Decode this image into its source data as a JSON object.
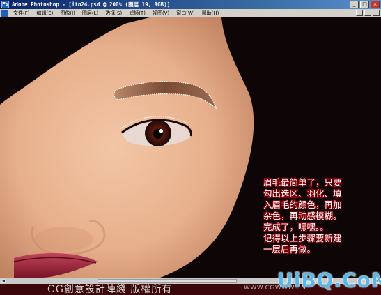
{
  "window": {
    "title": "Adobe Photoshop - [ito24.psd @ 200% (图层 19, RGB)]",
    "app_icon": "Ps",
    "buttons": [
      "_",
      "□",
      "×"
    ]
  },
  "menubar": {
    "items": [
      "文件(F)",
      "编辑(E)",
      "图像(I)",
      "图层(L)",
      "选择(S)",
      "滤镜(T)",
      "视图(V)",
      "窗口(W)",
      "帮助(H)"
    ]
  },
  "annotation": {
    "lines": [
      "眉毛最简单了，只要",
      "勾出选区、羽化、填",
      "入眉毛的颜色，再加",
      "杂色，再动感模糊。",
      "完成了，嘿嘿。。",
      "记得以上步骤要新建",
      "一层后再做。"
    ]
  },
  "footer": {
    "copyright": "CG創意設計陣綫 版權所有",
    "url": "WWW.CGWWW.CN"
  },
  "watermark": "UiBQ.CoM",
  "colors": {
    "titlebar": "#0a246a",
    "menubar": "#d4d0c8",
    "skin": "#e8b48f",
    "hair": "#0d0506",
    "note_outline": "#8c0008"
  },
  "icons": {
    "app": "photoshop-icon",
    "minimize": "minimize-icon",
    "maximize": "maximize-icon",
    "close": "close-icon"
  }
}
